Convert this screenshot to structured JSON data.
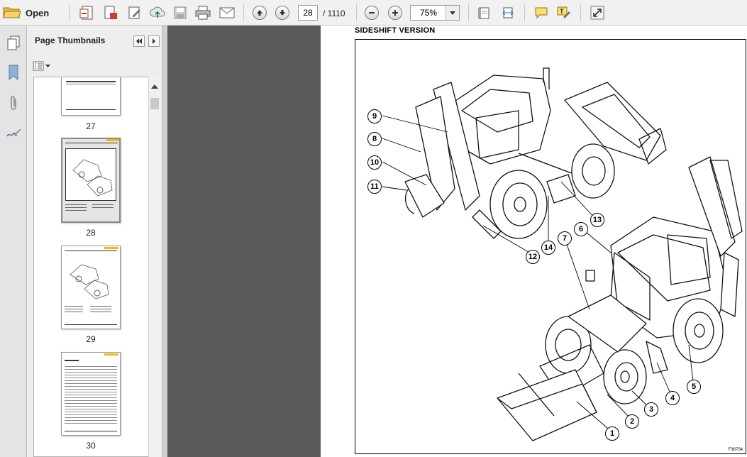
{
  "toolbar": {
    "open_label": "Open",
    "page_current": "28",
    "page_total": "/  1110",
    "zoom_value": "75%"
  },
  "panel": {
    "title": "Page Thumbnails",
    "thumbnails": [
      {
        "page": "27",
        "selected": false
      },
      {
        "page": "28",
        "selected": true
      },
      {
        "page": "29",
        "selected": false
      },
      {
        "page": "30",
        "selected": false
      }
    ]
  },
  "document": {
    "heading": "SIDESHIFT VERSION",
    "figure_id": "F36704",
    "callouts": [
      "1",
      "2",
      "3",
      "4",
      "5",
      "6",
      "7",
      "8",
      "9",
      "10",
      "11",
      "12",
      "13",
      "14"
    ]
  },
  "icons": {
    "open": "folder-open-icon",
    "create": "create-pdf-icon",
    "edit": "edit-icon",
    "upload": "cloud-upload-icon",
    "save": "save-icon",
    "print": "print-icon",
    "email": "email-icon",
    "prev": "previous-page-icon",
    "next": "next-page-icon",
    "zoom_out": "zoom-out-icon",
    "zoom_in": "zoom-in-icon",
    "fit_page": "fit-page-icon",
    "fit_width": "fit-width-icon",
    "comment": "comment-icon",
    "highlight": "highlight-icon",
    "fullscreen": "fullscreen-icon"
  }
}
